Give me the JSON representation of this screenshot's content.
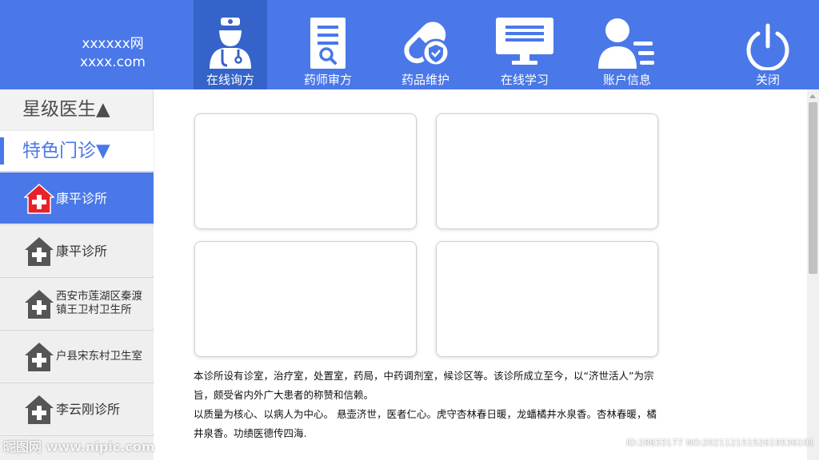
{
  "header": {
    "brand_line1": "xxxxxx网",
    "brand_line2": "xxxx.com",
    "nav": [
      {
        "label": "在线询方",
        "icon": "doctor-icon",
        "active": true
      },
      {
        "label": "药师审方",
        "icon": "prescription-icon",
        "active": false
      },
      {
        "label": "药品维护",
        "icon": "medicine-pill-icon",
        "active": false
      },
      {
        "label": "在线学习",
        "icon": "monitor-icon",
        "active": false
      },
      {
        "label": "账户信息",
        "icon": "account-icon",
        "active": false
      },
      {
        "label": "关闭",
        "icon": "power-icon",
        "active": false
      }
    ]
  },
  "sidebar": {
    "category_stars": "星级医生▲",
    "category_special": "特色门诊▼",
    "clinics": [
      {
        "label": "康平诊所",
        "active": true
      },
      {
        "label": "康平诊所",
        "active": false
      },
      {
        "label": "西安市莲湖区秦渡镇王卫村卫生所",
        "active": false
      },
      {
        "label": "户县宋东村卫生室",
        "active": false
      },
      {
        "label": "李云刚诊所",
        "active": false
      }
    ]
  },
  "main": {
    "description_p1": "本诊所设有诊室，治疗室，处置室，药局，中药调剂室，候诊区等。该诊所成立至今，以“济世活人”为宗旨，颇受省内外广大患者的称赞和信赖。",
    "description_p2": "以质量为核心、以病人为中心。 悬壶济世，医者仁心。虎守杏林春日暖，龙蟠橘井水泉香。杏林春暖，橘井泉香。功绩医德传四海."
  },
  "watermark": {
    "left": "昵图网 www.nipic.com",
    "right": "ID:28833177 NO:20211215152619536101"
  },
  "colors": {
    "primary": "#4a78e8",
    "active_nav": "#3563c9",
    "clinic_icon_red": "#e8222a",
    "clinic_icon_gray": "#555555"
  }
}
